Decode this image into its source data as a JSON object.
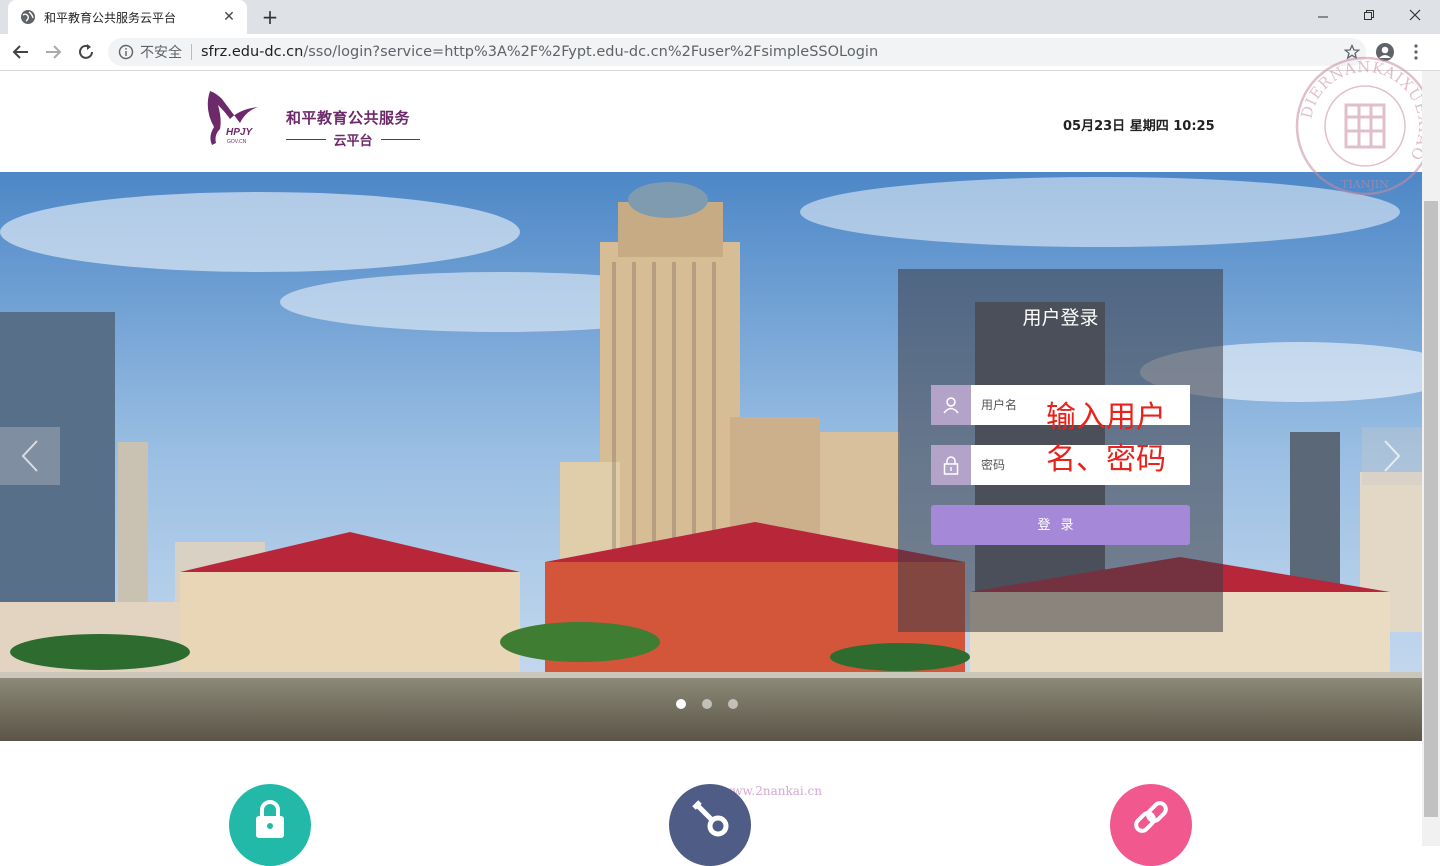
{
  "browser": {
    "tab_title": "和平教育公共服务云平台",
    "security_label": "不安全",
    "url_host": "sfrz.edu-dc.cn",
    "url_path": "/sso/login?service=http%3A%2F%2Fypt.edu-dc.cn%2Fuser%2FsimpleSSOLogin"
  },
  "header": {
    "logo_line1": "和平教育公共服务",
    "logo_line2": "云平台",
    "logo_mark_text": "HPJY",
    "logo_mark_sub": "GOV.CN",
    "datetime": "05月23日 星期四 10:25"
  },
  "stamp": {
    "ring_text": "DIERNANKAIXUEXIAO",
    "bottom_text": "TIANJIN"
  },
  "login": {
    "title": "用户登录",
    "username_placeholder": "用户名",
    "password_placeholder": "密码",
    "submit_label": "登录",
    "annotation_line1": "输入用户",
    "annotation_line2": "名、密码",
    "annotation_color": "#e8221c"
  },
  "carousel": {
    "slide_count": 3,
    "active_slide": 1
  },
  "watermark": "www.2nankai.cn",
  "features": [
    {
      "icon": "lock-icon",
      "color": "#23b9a9"
    },
    {
      "icon": "key-icon",
      "color": "#4f5c86"
    },
    {
      "icon": "link-icon",
      "color": "#f0588e"
    }
  ]
}
